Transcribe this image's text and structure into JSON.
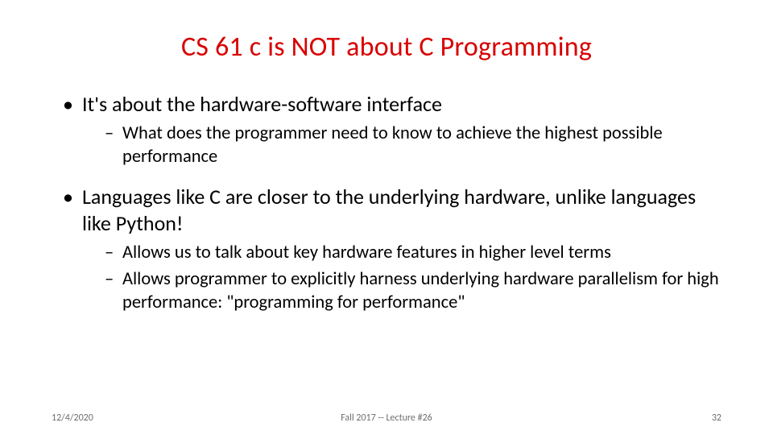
{
  "title": "CS 61 c is NOT about C Programming",
  "bullets": {
    "b1": "It's about the hardware-software interface",
    "b1_sub1": "What does the programmer need to know to achieve the highest possible performance",
    "b2": "Languages like C are closer to the underlying hardware, unlike languages like Python!",
    "b2_sub1": "Allows us to talk about key hardware features in higher level terms",
    "b2_sub2": "Allows programmer to explicitly harness underlying hardware parallelism for high performance: \"programming for performance\""
  },
  "footer": {
    "date": "12/4/2020",
    "center": "Fall 2017 -- Lecture #26",
    "page": "32"
  }
}
